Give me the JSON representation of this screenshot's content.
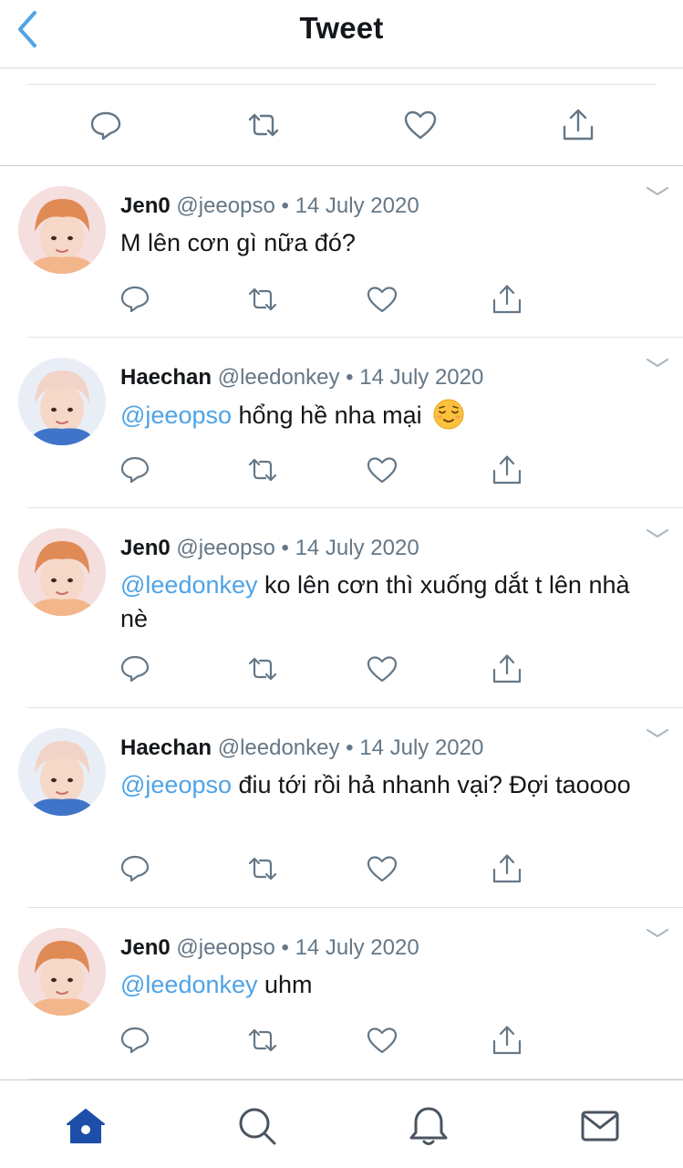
{
  "header": {
    "title": "Tweet",
    "back_icon": "chevron-left-icon"
  },
  "colors": {
    "mention": "#4fa3e6",
    "secondary": "#657786",
    "icon": "#657786",
    "tab_active": "#1d4fa8",
    "tab_inactive": "#4a5560"
  },
  "top_actions": [
    "reply-icon",
    "retweet-icon",
    "like-icon",
    "share-icon"
  ],
  "tweets": [
    {
      "name": "Jen0",
      "handle": "@jeeopso",
      "dot": "•",
      "date": "14 July 2020",
      "mention": "",
      "text": "M lên cơn gì nữa đó?"
    },
    {
      "name": "Haechan",
      "handle": "@leedonkey",
      "dot": "•",
      "date": "14 July 2020",
      "mention": "@jeeopso",
      "text": " hổng hề nha mại ",
      "emoji": "relieved-face-emoji"
    },
    {
      "name": "Jen0",
      "handle": "@jeeopso",
      "dot": "•",
      "date": "14 July 2020",
      "mention": "@leedonkey",
      "text": " ko lên cơn thì xuống dắt t lên nhà nè"
    },
    {
      "name": "Haechan",
      "handle": "@leedonkey",
      "dot": "•",
      "date": "14 July 2020",
      "mention": "@jeeopso",
      "text": " điu tới rồi hả nhanh vại? Đợi taoooo"
    },
    {
      "name": "Jen0",
      "handle": "@jeeopso",
      "dot": "•",
      "date": "14 July 2020",
      "mention": "@leedonkey",
      "text": " uhm"
    }
  ],
  "tabbar": [
    "home-icon",
    "search-icon",
    "notifications-icon",
    "messages-icon"
  ]
}
